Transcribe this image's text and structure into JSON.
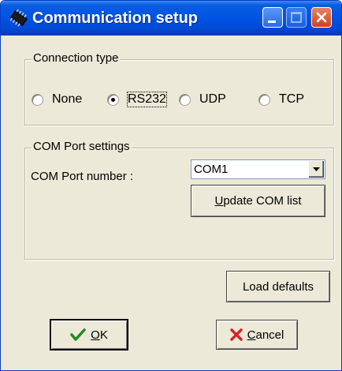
{
  "window": {
    "title": "Communication setup",
    "app_icon": "chip-icon"
  },
  "title_buttons": {
    "minimize": "minimize-icon",
    "maximize": "maximize-icon",
    "close": "close-icon"
  },
  "connection": {
    "group_title": "Connection type",
    "options": [
      {
        "label": "None",
        "selected": false
      },
      {
        "label": "RS232",
        "selected": true
      },
      {
        "label": "UDP",
        "selected": false
      },
      {
        "label": "TCP",
        "selected": false
      }
    ]
  },
  "com_port": {
    "group_title": "COM Port settings",
    "port_label": "COM Port number :",
    "port_value": "COM1",
    "update_accel": "U",
    "update_rest": "pdate COM list"
  },
  "buttons": {
    "load_defaults": "Load defaults",
    "ok_accel": "O",
    "ok_rest": "K",
    "cancel_accel": "C",
    "cancel_rest": "ancel"
  },
  "colors": {
    "title_bar": "#0054e3",
    "dialog_bg": "#ece9d8",
    "close_button": "#d0401b",
    "ok_check": "#1f8a1f",
    "cancel_x": "#d1262b"
  }
}
